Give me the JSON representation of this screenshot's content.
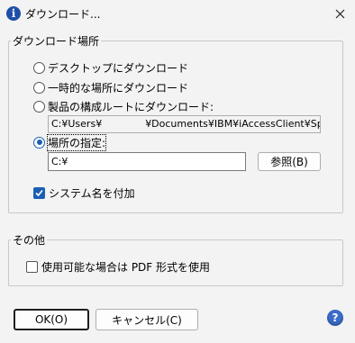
{
  "window": {
    "title": "ダウンロード..."
  },
  "download_location": {
    "legend": "ダウンロード場所",
    "options": [
      {
        "label": "デスクトップにダウンロード",
        "selected": false
      },
      {
        "label": "一時的な場所にダウンロード",
        "selected": false
      },
      {
        "label": "製品の構成ルートにダウンロード:",
        "selected": false
      },
      {
        "label": "場所の指定:",
        "selected": true
      }
    ],
    "product_root_path_start": "C:¥Users¥",
    "product_root_path_end": "¥Documents¥IBM¥iAccessClient¥Splf",
    "location_value": "C:¥",
    "browse_label": "参照(B)",
    "add_system_name_label": "システム名を付加",
    "add_system_name_checked": true
  },
  "other": {
    "legend": "その他",
    "use_pdf_label": "使用可能な場合は PDF 形式を使用",
    "use_pdf_checked": false
  },
  "buttons": {
    "ok": "OK(O)",
    "cancel": "キャンセル(C)"
  },
  "icons": [
    "info-icon",
    "close-icon",
    "help-icon",
    "checkmark-icon"
  ],
  "colors": {
    "accent": "#1a5fb4",
    "background": "#f3f3f3"
  }
}
